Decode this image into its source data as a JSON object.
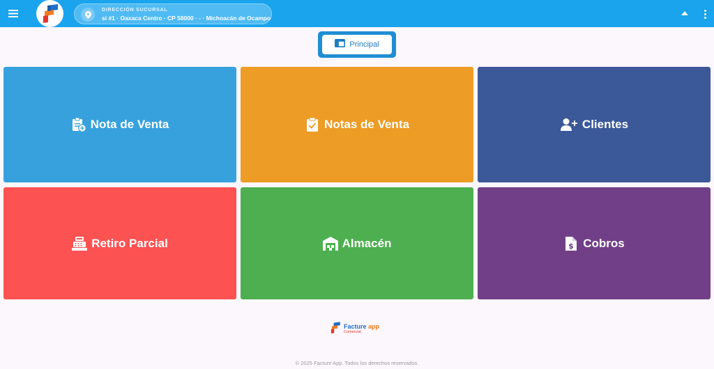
{
  "topbar": {
    "background": "#1aa4ee",
    "menu_icon": "hamburger-menu-icon",
    "logo_icon": "facture-app-logo-icon",
    "branch": {
      "label": "DIRECCIÓN SUCURSAL",
      "value": "sí #1 · Oaxaca Centro · CP 58000 · - · Michoacán de Ocampo",
      "icon": "location-pin-icon"
    },
    "caret_icon": "caret-up-icon",
    "more_icon": "more-vert-icon"
  },
  "main": {
    "section_button": {
      "label": "Principal",
      "icon": "window-icon"
    },
    "tiles": [
      {
        "label": "Nota de Venta",
        "icon": "clipboard-add-icon",
        "color": "#37a1dd"
      },
      {
        "label": "Notas de Venta",
        "icon": "clipboard-check-icon",
        "color": "#ed9c25"
      },
      {
        "label": "Clientes",
        "icon": "user-add-icon",
        "color": "#3b5899"
      },
      {
        "label": "Retiro Parcial",
        "icon": "cash-register-icon",
        "color": "#fc5252"
      },
      {
        "label": "Almacén",
        "icon": "warehouse-icon",
        "color": "#4daf50"
      },
      {
        "label": "Cobros",
        "icon": "invoice-dollar-icon",
        "color": "#713f87"
      }
    ]
  },
  "footer": {
    "brand_main": "Facture",
    "brand_accent": "app",
    "brand_sub": "Comercial",
    "copyright": "© 2025 Facture App. Todos los derechos reservados."
  }
}
